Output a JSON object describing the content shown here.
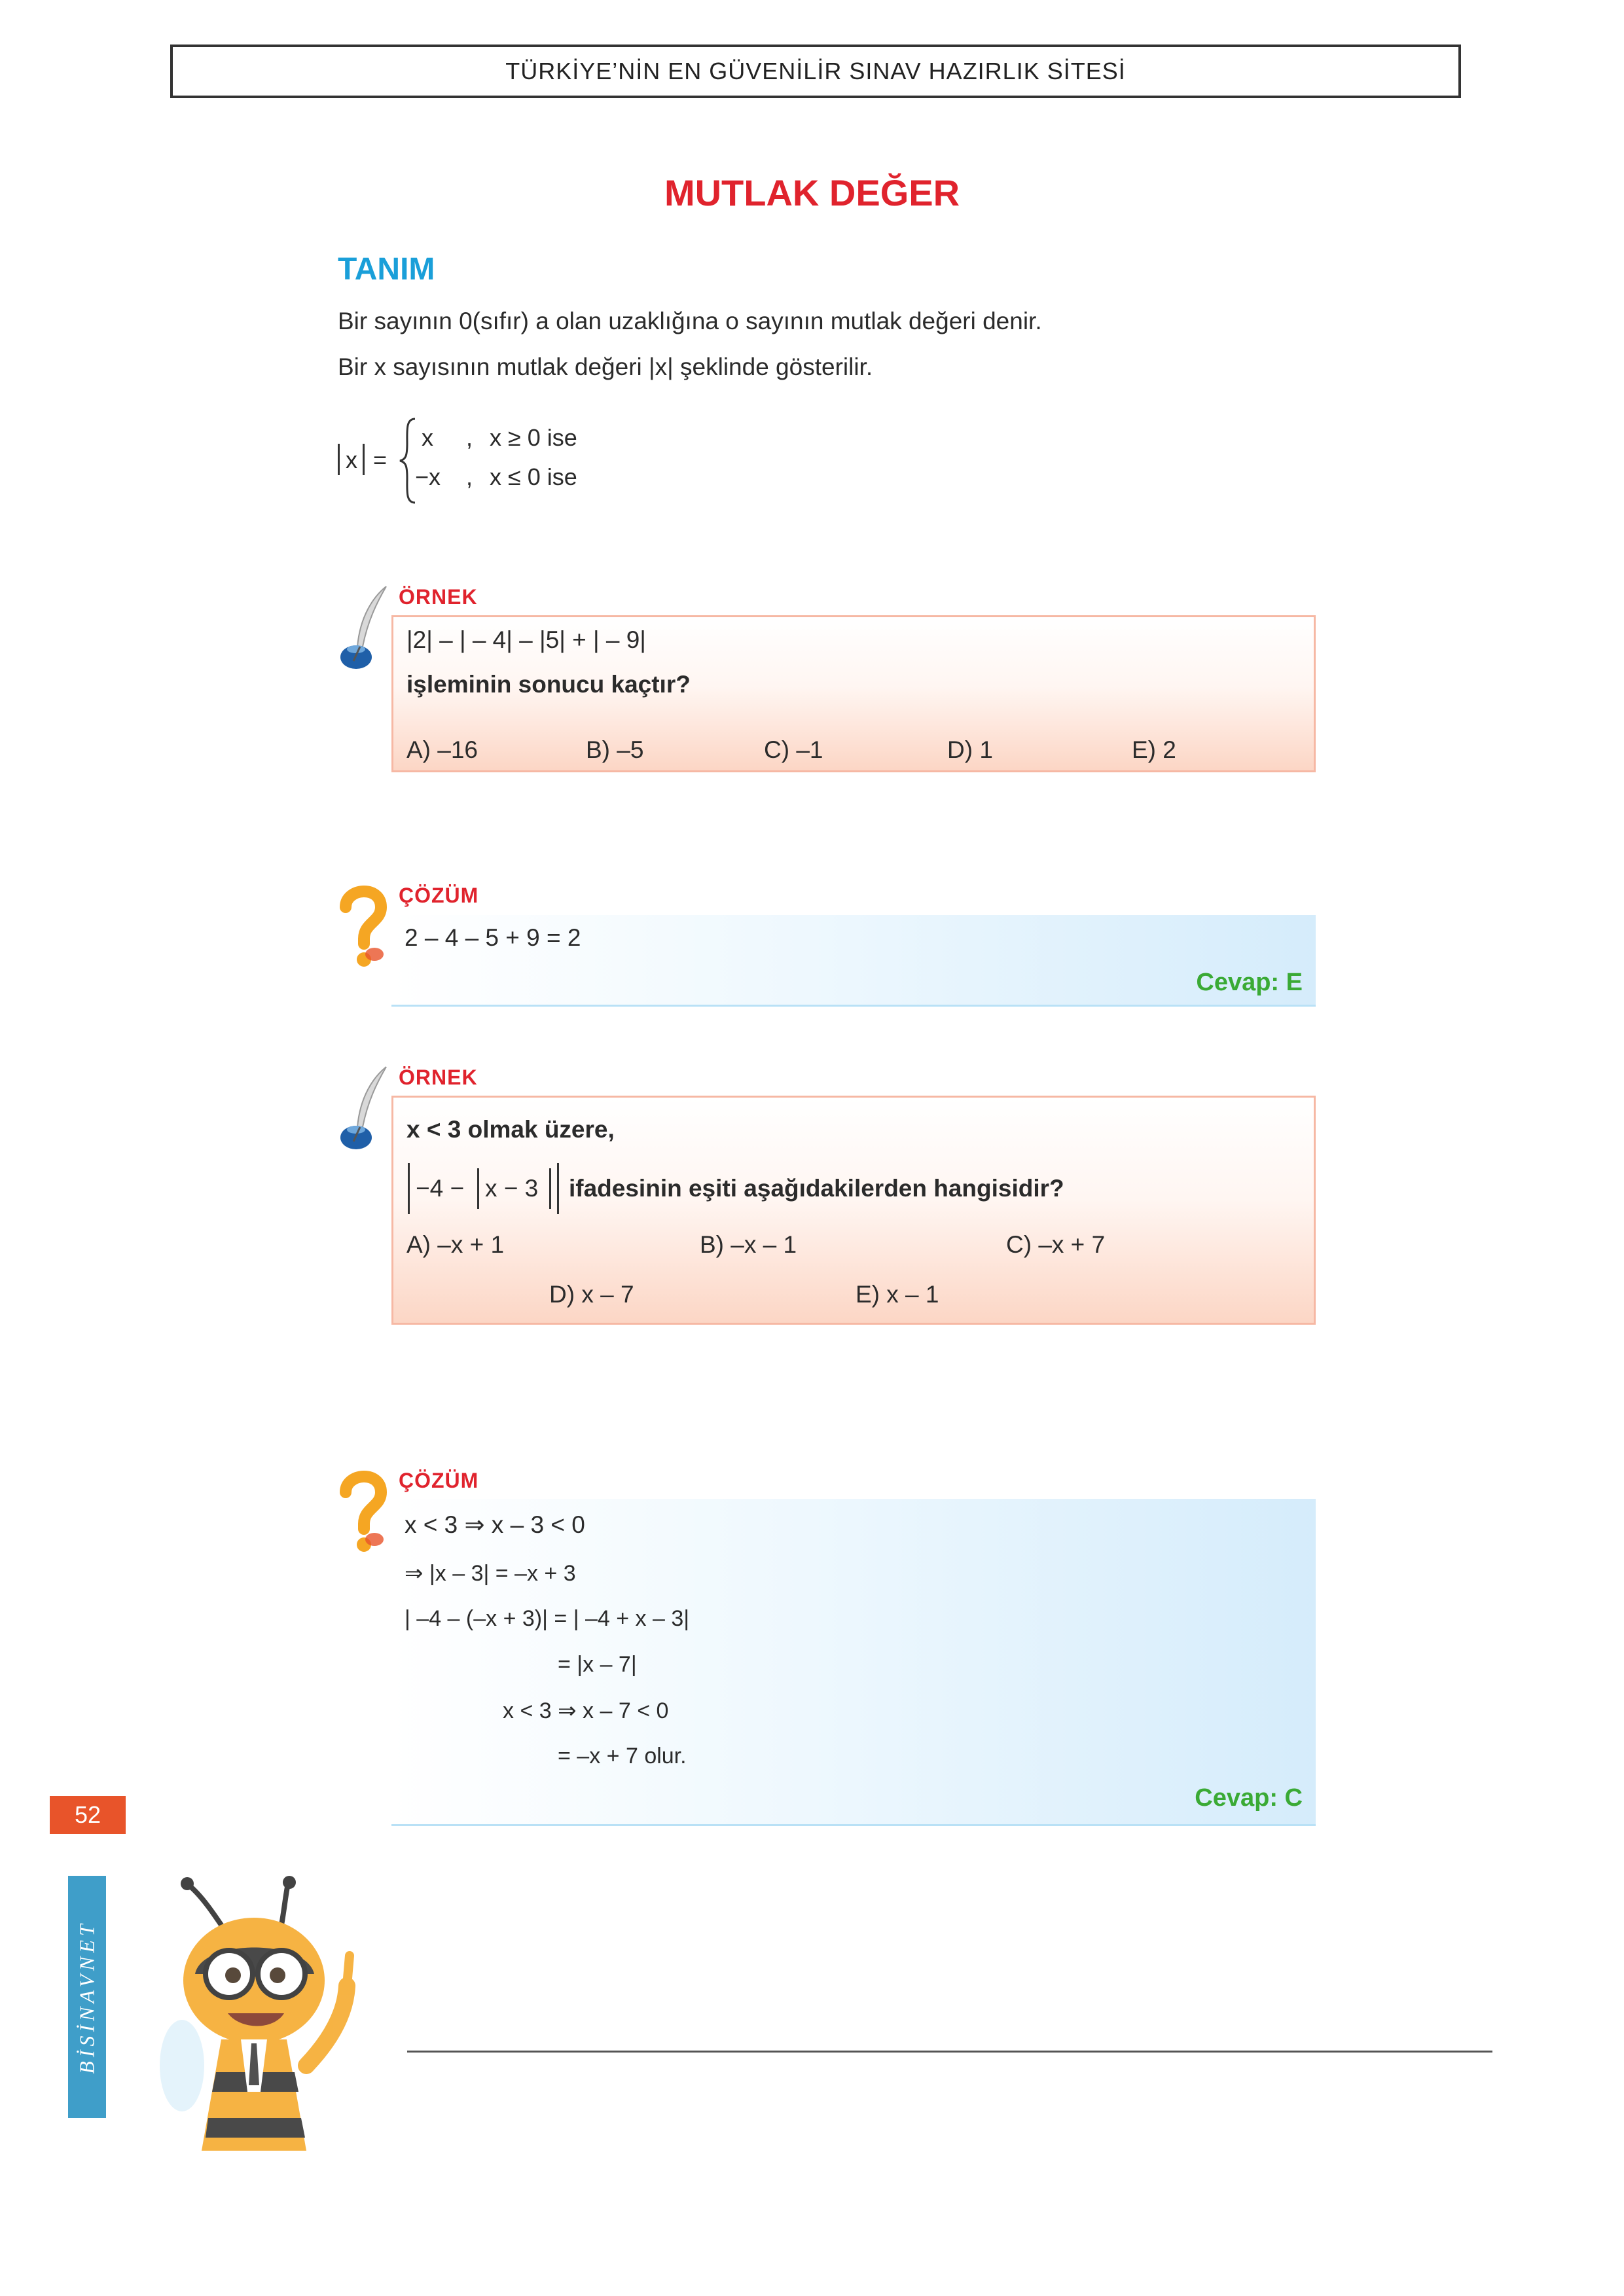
{
  "header": {
    "site_title": "TÜRKİYE’NİN EN GÜVENİLİR SINAV HAZIRLIK SİTESİ"
  },
  "page": {
    "title": "MUTLAK DEĞER",
    "number": "52",
    "brand_vertical": "BİSİNAVNET"
  },
  "definition": {
    "heading": "TANIM",
    "line1": "Bir sayının 0(sıfır) a olan uzaklığına o sayının mutlak değeri denir.",
    "line2": "Bir x sayısının mutlak değeri |x| şeklinde gösterilir.",
    "formula": {
      "lhs_var": "x",
      "equals": "=",
      "case1_expr": "x",
      "case1_comma": ",",
      "case1_cond": "x ≥ 0 ise",
      "case2_expr": "−x",
      "case2_comma": ",",
      "case2_cond": "x ≤ 0 ise"
    }
  },
  "example1": {
    "label": "ÖRNEK",
    "expression": "|2| – | – 4| – |5| + | – 9|",
    "question": "işleminin sonucu kaçtır?",
    "options": [
      "A) –16",
      "B) –5",
      "C) –1",
      "D) 1",
      "E) 2"
    ]
  },
  "solution1": {
    "label": "ÇÖZÜM",
    "line1": "2 – 4 – 5 + 9 = 2",
    "answer": "Cevap: E"
  },
  "example2": {
    "label": "ÖRNEK",
    "condition": "x < 3 olmak üzere,",
    "expr_part1": "−4 −",
    "expr_part2": "x − 3",
    "question": "ifadesinin eşiti aşağıdakilerden hangisidir?",
    "options": [
      "A) –x + 1",
      "B) –x – 1",
      "C) –x + 7",
      "D) x – 7",
      "E) x – 1"
    ]
  },
  "solution2": {
    "label": "ÇÖZÜM",
    "line1": "x < 3 ⇒ x – 3 < 0",
    "line2": "⇒ |x –  3| = –x + 3",
    "line3": "| –4 – (–x + 3)| = | –4 +  x –  3|",
    "line4": "= |x –  7|",
    "line5": "x < 3 ⇒ x – 7 < 0",
    "line6": "= –x + 7 olur.",
    "answer": "Cevap: C"
  },
  "icons": {
    "example_icon": "quill-inkwell-icon",
    "solution_icon": "question-mark-icon",
    "mascot": "bee-mascot-illustration"
  },
  "colors": {
    "title_red": "#e0232d",
    "heading_blue": "#1a9fd9",
    "answer_green": "#3aaa35",
    "page_badge": "#e8542a",
    "side_tab": "#3f9ec9"
  }
}
